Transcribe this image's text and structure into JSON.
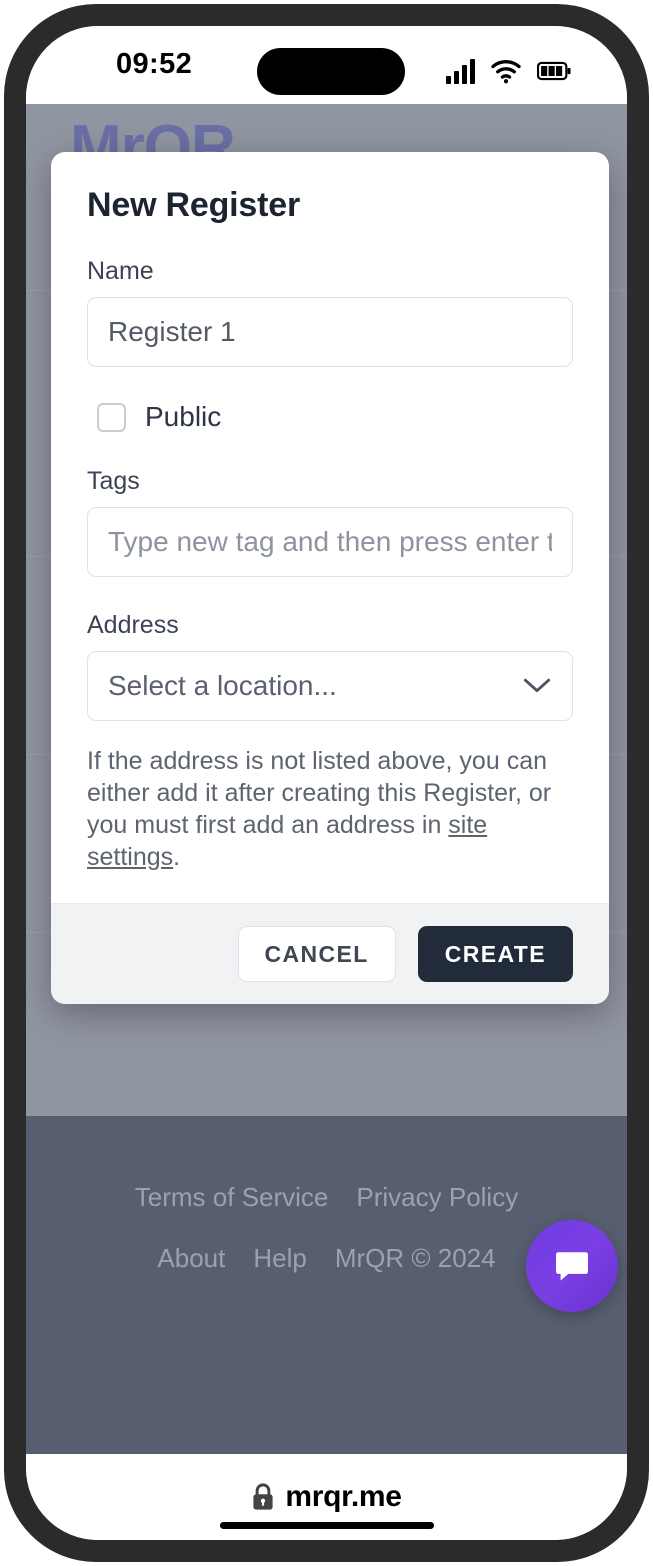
{
  "status_bar": {
    "time": "09:52",
    "icons": [
      "cellular-signal-icon",
      "wifi-icon",
      "battery-icon"
    ]
  },
  "browser": {
    "url": "mrqr.me",
    "secure_icon": "lock-icon"
  },
  "background_app": {
    "logo": "MrQR",
    "footer": {
      "row1": [
        {
          "label": "Terms of Service"
        },
        {
          "label": "Privacy Policy"
        }
      ],
      "row2": [
        {
          "label": "About"
        },
        {
          "label": "Help"
        }
      ],
      "copyright": "MrQR © 2024"
    },
    "chat_button": {
      "icon": "chat-bubble-icon",
      "color": "#7b3fe4"
    }
  },
  "modal": {
    "title": "New Register",
    "name_field": {
      "label": "Name",
      "value": "Register 1"
    },
    "public_checkbox": {
      "label": "Public",
      "checked": false
    },
    "tags_field": {
      "label": "Tags",
      "placeholder": "Type new tag and then press enter to"
    },
    "address_field": {
      "label": "Address",
      "selected": "Select a location...",
      "chevron": "chevron-down-icon"
    },
    "help_text": {
      "before_link": "If the address is not listed above, you can either add it after creating this Register, or you must first add an address in ",
      "link": "site settings",
      "after_link": "."
    },
    "actions": {
      "cancel": "CANCEL",
      "create": "CREATE"
    }
  },
  "colors": {
    "overlay": "#9095a2",
    "footer_bg": "#575e6f",
    "primary_button": "#212b3a",
    "accent": "#7b3fe4",
    "logo": "#6a6fa5"
  }
}
